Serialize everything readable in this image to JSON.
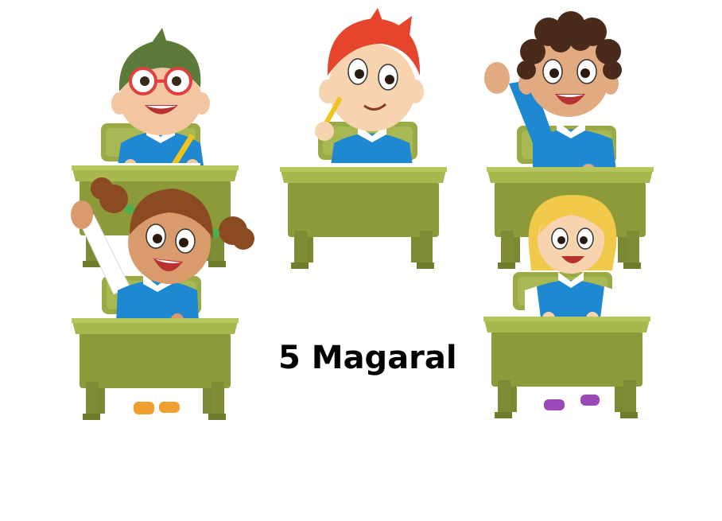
{
  "caption": "5 Magaral",
  "colors": {
    "desk_top": "#a3b34a",
    "desk_body": "#8c9a3a",
    "desk_leg": "#7a8a32",
    "chair": "#9aaa45",
    "shirt_blue": "#1e88d0",
    "skin": "#f3c6a2",
    "skin_dark": "#d99b6c"
  },
  "students": [
    {
      "name": "boy-glasses-green-hair",
      "hair": "#5c7a3a"
    },
    {
      "name": "boy-red-hair-pencil",
      "hair": "#e5452b"
    },
    {
      "name": "boy-curly-hair-hand-up",
      "hair": "#4a2a1a"
    },
    {
      "name": "girl-pigtails-hand-up",
      "hair": "#8a4a22"
    },
    {
      "name": "girl-blonde",
      "hair": "#f0c94a"
    }
  ]
}
